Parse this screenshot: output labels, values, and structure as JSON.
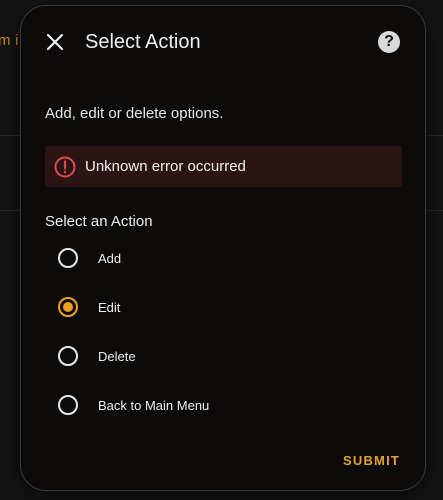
{
  "background": {
    "partial_text": "m i"
  },
  "dialog": {
    "title": "Select Action",
    "close_icon": "close-icon",
    "help_icon": "help-icon",
    "help_glyph": "?",
    "description": "Add, edit or delete options.",
    "error": {
      "icon": "error-circle-icon",
      "message": "Unknown error occurred",
      "color": "#e04a4a"
    },
    "section_label": "Select an Action",
    "options": [
      {
        "label": "Add",
        "checked": false
      },
      {
        "label": "Edit",
        "checked": true
      },
      {
        "label": "Delete",
        "checked": false
      },
      {
        "label": "Back to Main Menu",
        "checked": false
      }
    ],
    "submit_label": "SUBMIT",
    "accent_color": "#f0a020"
  }
}
